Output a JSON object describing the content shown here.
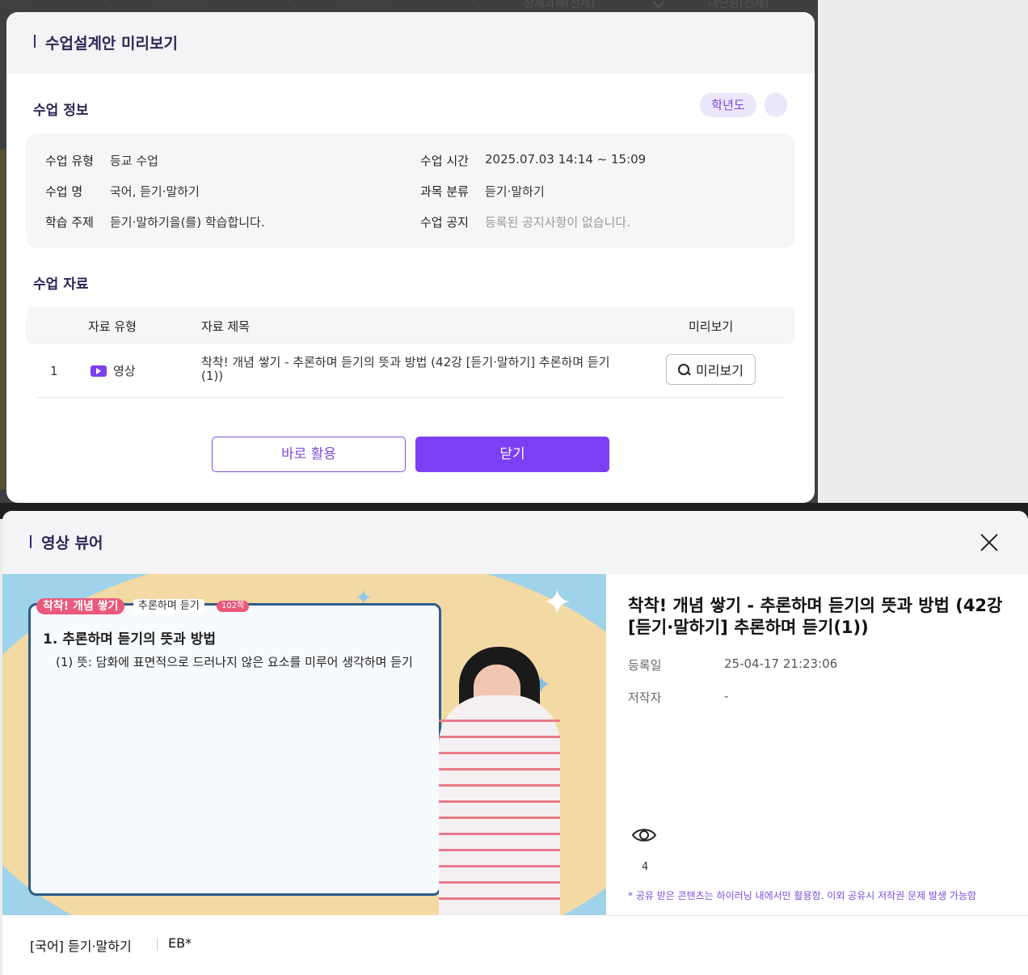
{
  "background": {
    "filters": [
      "교과정",
      "학년(전체)",
      "과목(전체)",
      "상세과목(전체)",
      "내단원(전체)"
    ]
  },
  "lesson_modal": {
    "title": "수업설계안 미리보기",
    "info_section": {
      "title": "수업 정보",
      "year_chip": "학년도",
      "rows": [
        {
          "label": "수업 유형",
          "value": "등교 수업"
        },
        {
          "label": "수업 명",
          "value": "국어, 듣기·말하기"
        },
        {
          "label": "학습 주제",
          "value": "듣기·말하기을(를) 학습합니다."
        },
        {
          "label": "수업 시간",
          "value": "2025.07.03 14:14 ~ 15:09"
        },
        {
          "label": "과목 분류",
          "value": "듣기·말하기"
        },
        {
          "label": "수업 공지",
          "value": "등록된 공지사항이 없습니다."
        }
      ]
    },
    "materials_section": {
      "title": "수업 자료",
      "columns": [
        "자료 유형",
        "자료 제목",
        "미리보기"
      ],
      "rows": [
        {
          "num": "1",
          "type": "영상",
          "title": "착착! 개념 쌓기 - 추론하며 듣기의 뜻과 방법 (42강 [듣기·말하기] 추론하며 듣기(1))",
          "preview_label": "미리보기"
        }
      ]
    },
    "buttons": {
      "use_now": "바로 활용",
      "close": "닫기"
    }
  },
  "video_viewer": {
    "title": "영상 뷰어",
    "video_overlay": {
      "tag_main": "착착! 개념 쌓기",
      "tag_sub": "추론하며 듣기",
      "tag_num": "102쪽",
      "heading": "1. 추론하며 듣기의 뜻과 방법",
      "subline": "(1) 뜻: 담화에 표면적으로 드러나지 않은 요소를 미루어 생각하며 듣기"
    },
    "video_title": "착착! 개념 쌓기 - 추론하며 듣기의 뜻과 방법 (42강 [듣기·말하기] 추론하며 듣기(1))",
    "meta": [
      {
        "label": "등록일",
        "value": "25-04-17 21:23:06"
      },
      {
        "label": "저작자",
        "value": "-"
      }
    ],
    "view_count": "4",
    "notice": "* 공유 받은 콘텐츠는 하이러닝 내에서만 활용함. 이외 공유시 저작권 문제 발생 가능함",
    "footer": {
      "category": "[국어] 듣기·말하기",
      "publisher": "EB*"
    }
  },
  "colors": {
    "accent": "#7c3ff3",
    "title": "#2d2659",
    "chip_bg": "#ece6fb"
  }
}
